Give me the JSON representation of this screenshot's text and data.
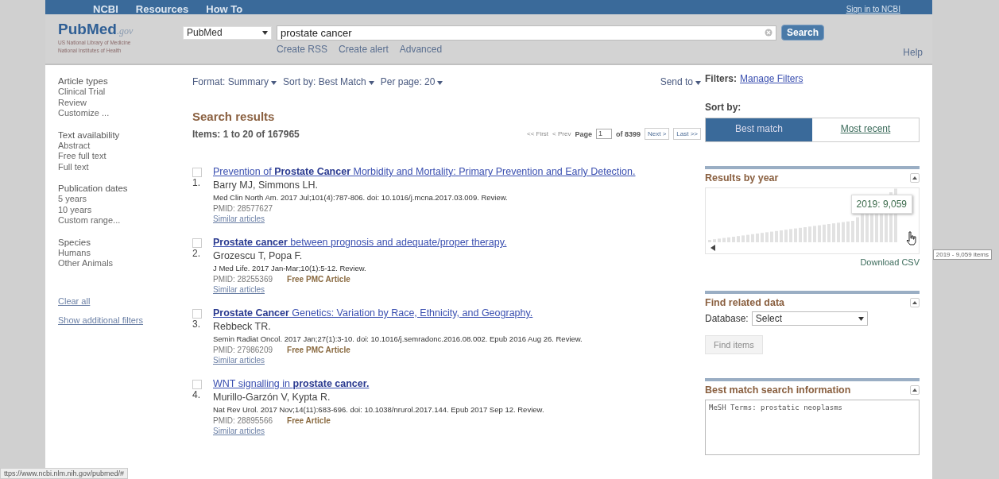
{
  "top_bar": {
    "items": [
      "NCBI",
      "Resources",
      "How To"
    ],
    "sign_in": "Sign in to NCBI"
  },
  "header": {
    "logo": {
      "text": "PubMed",
      "suffix": ".gov",
      "subtitle": [
        "US National Library of Medicine",
        "National Institutes of Health"
      ]
    },
    "database": "PubMed",
    "query": "prostate cancer",
    "search_button": "Search",
    "links": [
      "Create RSS",
      "Create alert",
      "Advanced"
    ],
    "help": "Help"
  },
  "sidebar": {
    "groups": [
      {
        "title": "Article types",
        "items": [
          "Clinical Trial",
          "Review",
          "Customize ..."
        ]
      },
      {
        "title": "Text availability",
        "items": [
          "Abstract",
          "Free full text",
          "Full text"
        ]
      },
      {
        "title": "Publication dates",
        "items": [
          "5 years",
          "10 years",
          "Custom range..."
        ]
      },
      {
        "title": "Species",
        "items": [
          "Humans",
          "Other Animals"
        ]
      }
    ],
    "links": [
      "Clear all",
      "Show additional filters"
    ]
  },
  "toolbar": {
    "options": [
      {
        "label": "Format:",
        "value": "Summary"
      },
      {
        "label": "Sort by:",
        "value": "Best Match"
      },
      {
        "label": "Per page:",
        "value": "20"
      }
    ],
    "send_to": "Send to"
  },
  "results": {
    "heading": "Search results",
    "count": "Items: 1 to 20 of 167965",
    "pager": {
      "first": "<< First",
      "prev": "< Prev",
      "page_label": "Page",
      "page": "1",
      "of": "of 8399",
      "next": "Next >",
      "last": "Last >>",
      "first_disabled": true
    },
    "items": [
      {
        "checked": false,
        "number": "1.",
        "title": "Prevention of **Prostate Cancer** Morbidity and Mortality: Primary Prevention and Early Detection.",
        "authors": "Barry MJ, Simmons LH.",
        "citation": "Med Clin North Am. 2017 Jul;101(4):787-806. doi: 10.1016/j.mcna.2017.03.009. Review.",
        "pmid": "PMID: 28577627",
        "similar": "Similar articles"
      },
      {
        "checked": false,
        "number": "2.",
        "title": "**Prostate cancer** between prognosis and adequate/proper therapy.",
        "authors": "Grozescu T, Popa F.",
        "citation": "J Med Life. 2017 Jan-Mar;10(1):5-12. Review.",
        "pmid": "PMID: 28255369",
        "free": "Free PMC Article",
        "similar": "Similar articles"
      },
      {
        "checked": false,
        "number": "3.",
        "title": "**Prostate Cancer** Genetics: Variation by Race, Ethnicity, and Geography.",
        "authors": "Rebbeck TR.",
        "citation": "Semin Radiat Oncol. 2017 Jan;27(1):3-10. doi: 10.1016/j.semradonc.2016.08.002. Epub 2016 Aug 26. Review.",
        "pmid": "PMID: 27986209",
        "free": "Free PMC Article",
        "similar": "Similar articles"
      },
      {
        "checked": false,
        "number": "4.",
        "title": "WNT signalling in **prostate cancer.**",
        "authors": "Murillo-Garzón V, Kypta R.",
        "citation": "Nat Rev Urol. 2017 Nov;14(11):683-696. doi: 10.1038/nrurol.2017.144. Epub 2017 Sep 12. Review.",
        "pmid": "PMID: 28895566",
        "free": "Free Article",
        "similar": "Similar articles"
      }
    ]
  },
  "right": {
    "filters_label": "Filters:",
    "manage_filters": "Manage Filters",
    "sort_label": "Sort by:",
    "sort_options": [
      {
        "label": "Best match",
        "selected": true
      },
      {
        "label": "Most recent",
        "selected": false
      }
    ],
    "results_by_year": {
      "title": "Results by year",
      "bar_tooltip": "2019: 9,059",
      "hover_tooltip": "2019 - 9,059 items",
      "download": "Download CSV"
    },
    "related": {
      "title": "Find related data",
      "database_label": "Database:",
      "database_value": "Select",
      "button": "Find items",
      "button_disabled": true
    },
    "best_match": {
      "title": "Best match search information",
      "text": "MeSH Terms: prostatic neoplasms"
    }
  },
  "status_bar": "ttps://www.ncbi.nlm.nih.gov/pubmed/#"
}
